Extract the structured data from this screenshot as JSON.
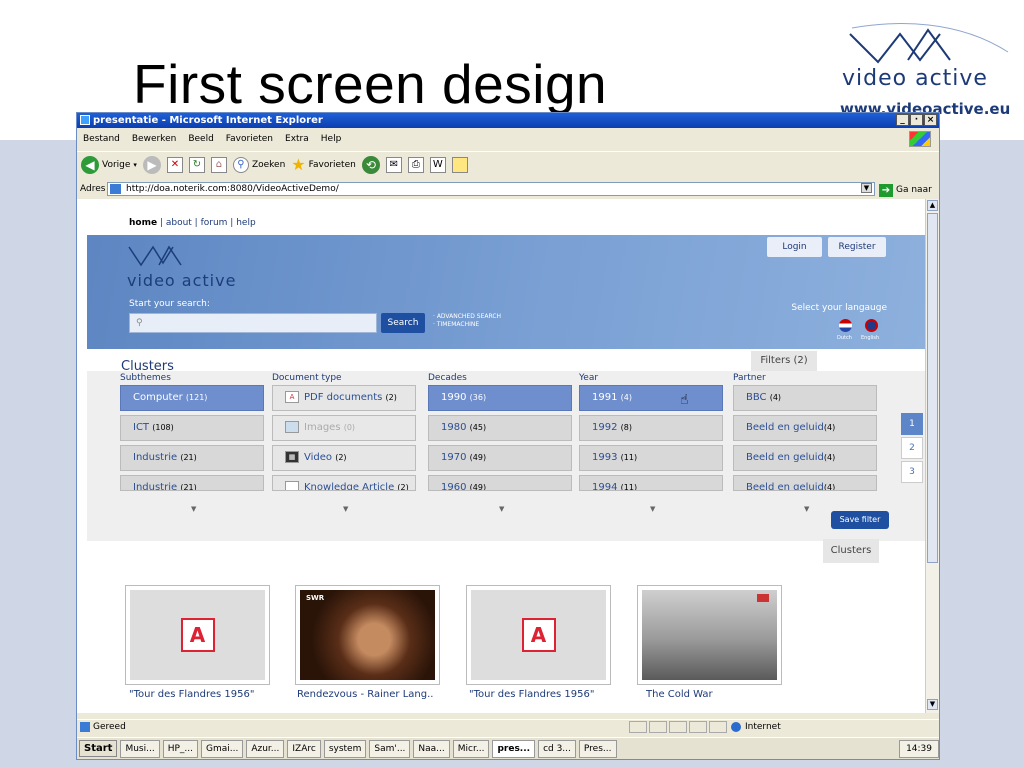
{
  "slide": {
    "title": "First screen design",
    "brand_name": "video active",
    "brand_url": "www.videoactive.eu"
  },
  "browser": {
    "window_title": "presentatie - Microsoft Internet Explorer",
    "window_buttons": [
      "_",
      "·",
      "×"
    ],
    "menu": [
      "Bestand",
      "Bewerken",
      "Beeld",
      "Favorieten",
      "Extra",
      "Help"
    ],
    "toolbar": {
      "back": "Vorige",
      "search": "Zoeken",
      "favorites": "Favorieten"
    },
    "address_label": "Adres",
    "address_value": "http://doa.noterik.com:8080/VideoActiveDemo/",
    "go_label": "Ga naar",
    "status_text": "Gereed",
    "zone_text": "Internet"
  },
  "site": {
    "nav": {
      "home": "home",
      "about": "about",
      "forum": "forum",
      "help": "help"
    },
    "brand": "video active",
    "start_search": "Start your search:",
    "search_button": "Search",
    "advanced_link": "· ADVANCHED SEARCH",
    "timemachine_link": "· TIMEMACHINE",
    "login": "Login",
    "register": "Register",
    "select_language": "Select your langauge",
    "lang_dutch": "Dutch",
    "lang_english": "English",
    "clusters_title": "Clusters",
    "filters_tab": "Filters (2)",
    "save_filter": "Save filter",
    "clusters_tab": "Clusters",
    "columns": {
      "subthemes": {
        "title": "Subthemes",
        "items": [
          {
            "label": "Computer",
            "count": "(121)"
          },
          {
            "label": "ICT",
            "count": "(108)"
          },
          {
            "label": "Industrie",
            "count": "(21)"
          },
          {
            "label": "Industrie",
            "count": "(21)"
          }
        ]
      },
      "document_type": {
        "title": "Document type",
        "items": [
          {
            "label": "PDF documents",
            "count": "(2)"
          },
          {
            "label": "Images",
            "count": "(0)"
          },
          {
            "label": "Video",
            "count": "(2)"
          },
          {
            "label": "Knowledge Article",
            "count": "(2)"
          }
        ]
      },
      "decades": {
        "title": "Decades",
        "items": [
          {
            "label": "1990",
            "count": "(36)"
          },
          {
            "label": "1980",
            "count": "(45)"
          },
          {
            "label": "1970",
            "count": "(49)"
          },
          {
            "label": "1960",
            "count": "(49)"
          }
        ]
      },
      "year": {
        "title": "Year",
        "items": [
          {
            "label": "1991",
            "count": "(4)"
          },
          {
            "label": "1992",
            "count": "(8)"
          },
          {
            "label": "1993",
            "count": "(11)"
          },
          {
            "label": "1994",
            "count": "(11)"
          }
        ]
      },
      "partner": {
        "title": "Partner",
        "items": [
          {
            "label": "BBC",
            "count": "(4)"
          },
          {
            "label": "Beeld en geluid",
            "count": "(4)"
          },
          {
            "label": "Beeld en geluid",
            "count": "(4)"
          },
          {
            "label": "Beeld en geluid",
            "count": "(4)"
          }
        ]
      }
    },
    "pages": [
      "1",
      "2",
      "3"
    ],
    "results": [
      {
        "caption": "\"Tour des Flandres 1956\"",
        "kind": "pdf"
      },
      {
        "caption": "Rendezvous - Rainer Lang..",
        "kind": "video",
        "badge": "SWR"
      },
      {
        "caption": "\"Tour des Flandres 1956\"",
        "kind": "pdf"
      },
      {
        "caption": "The Cold War",
        "kind": "photo"
      }
    ]
  },
  "taskbar": {
    "start": "Start",
    "items": [
      "Musi...",
      "HP_...",
      "Gmai...",
      "Azur...",
      "IZArc",
      "system",
      "Sam'...",
      "Naa...",
      "Micr...",
      "pres...",
      "cd 3...",
      "Pres..."
    ],
    "active_index": 9,
    "clock": "14:39"
  }
}
